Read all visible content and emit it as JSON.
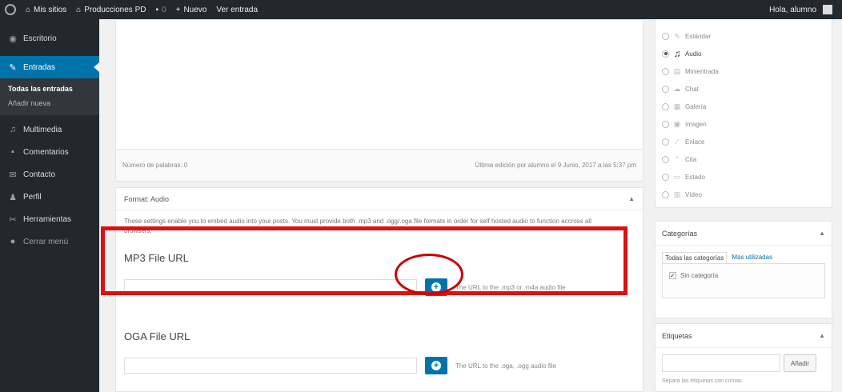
{
  "adminbar": {
    "my_sites": "Mis sitios",
    "site_name": "Producciones PD",
    "comments_count": "0",
    "new_label": "Nuevo",
    "view_entry": "Ver entrada",
    "greeting": "Hola, alumno"
  },
  "sidebar": {
    "items": [
      {
        "label": "Escritorio"
      },
      {
        "label": "Entradas"
      },
      {
        "label": "Multimedia"
      },
      {
        "label": "Comentarios"
      },
      {
        "label": "Contacto"
      },
      {
        "label": "Perfil"
      },
      {
        "label": "Herramientas"
      },
      {
        "label": "Cerrar menú"
      }
    ],
    "submenu": [
      "Todas las entradas",
      "Añadir nueva"
    ]
  },
  "editor": {
    "word_count": "Número de palabras: 0",
    "last_edit": "Última edición por alumno el 9 Junio, 2017 a las 5:37 pm"
  },
  "format_box": {
    "title": "Format: Audio",
    "description": "These settings enable you to embed audio into your posts. You must provide both .mp3 and .ogg/.oga file formats in order for self hosted audio to function accross all browsers.",
    "mp3": {
      "label": "MP3 File URL",
      "value": "",
      "hint": "The URL to the .mp3 or .m4a audio file"
    },
    "oga": {
      "label": "OGA File URL",
      "value": "",
      "hint": "The URL to the .oga, .ogg audio file"
    }
  },
  "post_formats": {
    "selected": "Audio",
    "items": [
      {
        "label": "Estándar",
        "icon": "pin-icon"
      },
      {
        "label": "Audio",
        "icon": "music-icon"
      },
      {
        "label": "Minientrada",
        "icon": "aside-icon"
      },
      {
        "label": "Chat",
        "icon": "chat-icon"
      },
      {
        "label": "Galería",
        "icon": "gallery-icon"
      },
      {
        "label": "Imagen",
        "icon": "image-icon"
      },
      {
        "label": "Enlace",
        "icon": "link-icon"
      },
      {
        "label": "Cita",
        "icon": "quote-icon"
      },
      {
        "label": "Estado",
        "icon": "status-icon"
      },
      {
        "label": "Vídeo",
        "icon": "video-icon"
      }
    ]
  },
  "categories": {
    "title": "Categorías",
    "tab_all": "Todas las categorías",
    "tab_used": "Más utilizadas",
    "items": [
      {
        "label": "Sin categoría",
        "checked": true
      }
    ]
  },
  "tags": {
    "title": "Etiquetas",
    "input_value": "",
    "add_button": "Añadir",
    "hint": "Separa las etiquetas con comas."
  },
  "colors": {
    "admin_bg": "#23282d",
    "accent": "#0073aa",
    "highlight": "#dd1111"
  }
}
